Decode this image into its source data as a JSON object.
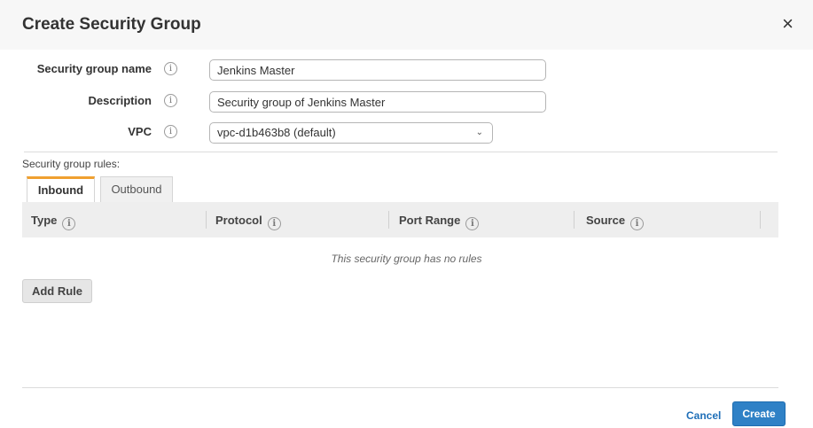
{
  "dialog": {
    "title": "Create Security Group",
    "close_symbol": "×"
  },
  "form": {
    "name_label": "Security group name",
    "name_value": "Jenkins Master",
    "description_label": "Description",
    "description_value": "Security group of Jenkins Master",
    "vpc_label": "VPC",
    "vpc_value": "vpc-d1b463b8 (default)",
    "info_symbol": "i"
  },
  "rules": {
    "section_label": "Security group rules:",
    "tabs": [
      {
        "label": "Inbound",
        "active": true
      },
      {
        "label": "Outbound",
        "active": false
      }
    ],
    "columns": [
      "Type",
      "Protocol",
      "Port Range",
      "Source"
    ],
    "empty_message": "This security group has no rules",
    "add_rule_label": "Add Rule"
  },
  "footer": {
    "cancel_label": "Cancel",
    "create_label": "Create"
  },
  "colors": {
    "primary": "#2f81c6",
    "link": "#1f6fb8",
    "tab_accent": "#f0a030"
  },
  "icons": {
    "close": "close-icon",
    "info": "info-icon",
    "select_chevron": "chevron-down-icon"
  }
}
